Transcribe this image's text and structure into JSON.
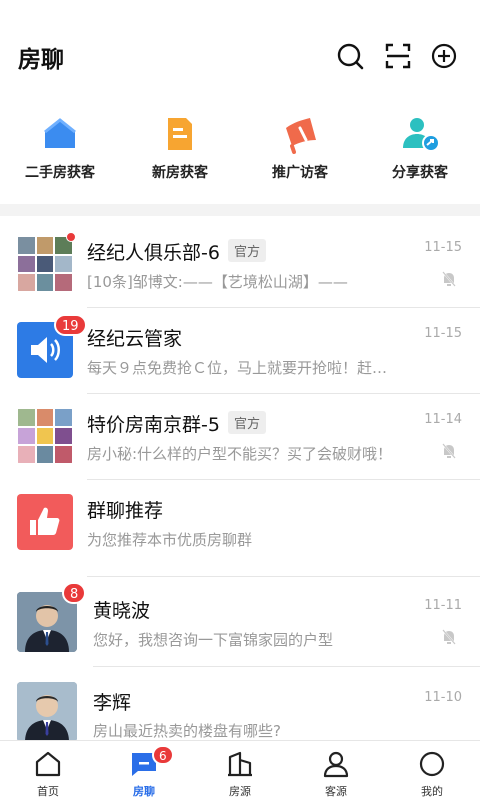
{
  "header": {
    "title": "房聊"
  },
  "colors": {
    "accent": "#2a6ee8",
    "badge": "#e93a3a"
  },
  "quick_actions": [
    {
      "label": "二手房获客",
      "icon": "house-icon"
    },
    {
      "label": "新房获客",
      "icon": "building-icon"
    },
    {
      "label": "推广访客",
      "icon": "megaphone-icon"
    },
    {
      "label": "分享获客",
      "icon": "share-user-icon"
    }
  ],
  "chats": [
    {
      "name": "经纪人俱乐部-6",
      "tag": "官方",
      "preview": "[10条]邹博文:——【艺境松山湖】——",
      "time": "11-15",
      "muted": true,
      "unread_dot": true
    },
    {
      "name": "经纪云管家",
      "preview": "每天９点免费抢Ｃ位，马上就要开抢啦！赶…",
      "time": "11-15",
      "badge": "19"
    },
    {
      "name": "特价房南京群-5",
      "tag": "官方",
      "preview": "房小秘:什么样的户型不能买？买了会破财哦！",
      "time": "11-14",
      "muted": true
    },
    {
      "name": "群聊推荐",
      "preview": "为您推荐本市优质房聊群"
    },
    {
      "name": "黄晓波",
      "preview": "您好，我想咨询一下富锦家园的户型",
      "time": "11-11",
      "muted": true,
      "badge": "8"
    },
    {
      "name": "李辉",
      "preview": "房山最近热卖的楼盘有哪些?",
      "time": "11-10"
    }
  ],
  "tabbar": {
    "items": [
      {
        "label": "首页",
        "icon": "home-icon"
      },
      {
        "label": "房聊",
        "icon": "chat-icon",
        "active": true,
        "badge": "6"
      },
      {
        "label": "房源",
        "icon": "buildings-icon"
      },
      {
        "label": "客源",
        "icon": "person-icon"
      },
      {
        "label": "我的",
        "icon": "circle-icon"
      }
    ]
  }
}
